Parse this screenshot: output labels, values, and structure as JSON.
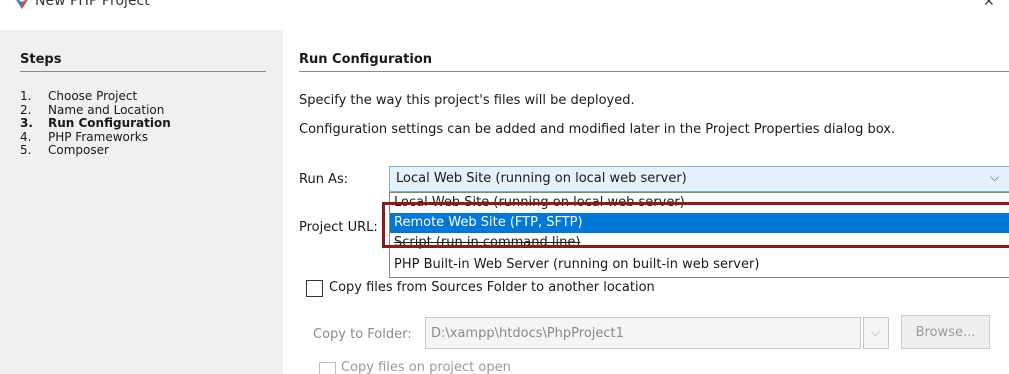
{
  "window": {
    "title": "New PHP Project",
    "close_glyph": "✕",
    "icon": "netbeans-icon"
  },
  "steps": {
    "heading": "Steps",
    "items": [
      {
        "num": "1.",
        "label": "Choose Project"
      },
      {
        "num": "2.",
        "label": "Name and Location"
      },
      {
        "num": "3.",
        "label": "Run Configuration",
        "current": true
      },
      {
        "num": "4.",
        "label": "PHP Frameworks"
      },
      {
        "num": "5.",
        "label": "Composer"
      }
    ]
  },
  "panel": {
    "heading": "Run Configuration",
    "description_1": "Specify the way this project's files will be deployed.",
    "description_2": "Configuration settings can be added and modified later in the Project Properties dialog box."
  },
  "run_as": {
    "label": "Run As:",
    "selected": "Local Web Site (running on local web server)",
    "options": [
      "Local Web Site (running on local web server)",
      "Remote Web Site (FTP, SFTP)",
      "Script (run in command line)",
      "PHP Built-in Web Server (running on built-in web server)"
    ],
    "highlighted_index": 1
  },
  "project_url": {
    "label": "Project URL:"
  },
  "copy_files": {
    "label": "Copy files from Sources Folder to another location",
    "checked": false
  },
  "copy_to": {
    "label": "Copy to Folder:",
    "value": "D:\\xampp\\htdocs\\PhpProject1",
    "browse_label": "Browse..."
  },
  "copy_on_open": {
    "label": "Copy files on project open",
    "checked": false
  },
  "colors": {
    "selection": "#0078d7",
    "callout": "#8b1a1a",
    "combo_bg": "#e5f1fb",
    "steps_bg": "#f0f0f0"
  }
}
